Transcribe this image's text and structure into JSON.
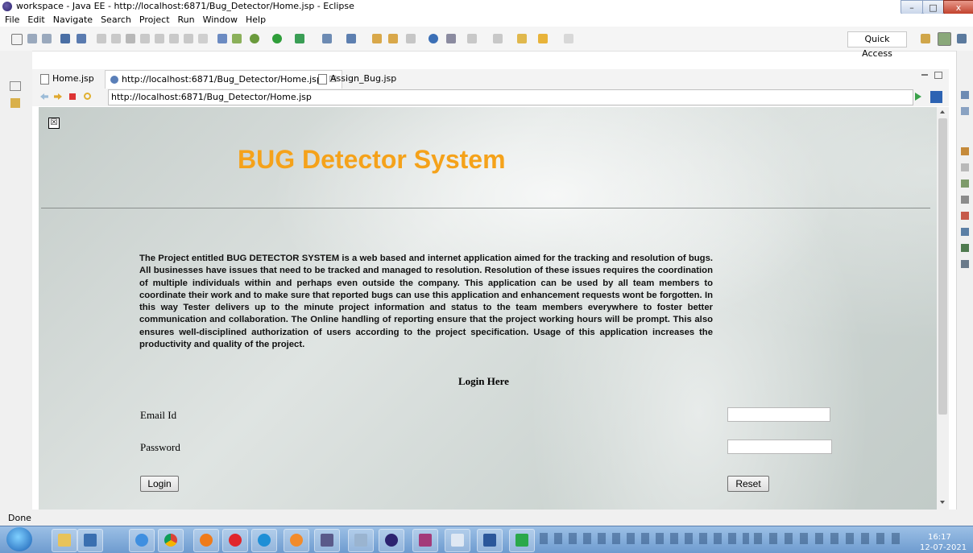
{
  "window": {
    "title": "workspace - Java EE - http://localhost:6871/Bug_Detector/Home.jsp - Eclipse",
    "controls": [
      "–",
      "□",
      "x"
    ]
  },
  "menu": [
    "File",
    "Edit",
    "Navigate",
    "Search",
    "Project",
    "Run",
    "Window",
    "Help"
  ],
  "toolbar": {
    "quick_access": "Quick Access"
  },
  "tabs": [
    {
      "label": "Home.jsp"
    },
    {
      "label": "http://localhost:6871/Bug_Detector/Home.jsp",
      "close": "☒"
    },
    {
      "label": "Assign_Bug.jsp"
    }
  ],
  "browser": {
    "url": "http://localhost:6871/Bug_Detector/Home.jsp"
  },
  "page": {
    "broken_image": "☒",
    "title": "BUG Detector System",
    "description": "The Project entitled BUG DETECTOR SYSTEM is a web based and internet application aimed for the tracking and resolution of bugs. All businesses have issues that need to be tracked and managed to resolution. Resolution of these issues requires the coordination of multiple individuals within and perhaps even outside the company. This application can be used by all team members to coordinate their work and to make sure that reported bugs can use this application and enhancement requests wont be forgotten. In this way Tester delivers up to the minute project information and status to the team members everywhere to foster better communication and collaboration. The Online handling of reporting ensure that the project working hours will be prompt. This also ensures well-disciplined authorization of users according to the project specification. Usage of this application increases the productivity and quality of the project.",
    "login_heading": "Login Here",
    "email_label": "Email Id",
    "email_value": "",
    "password_label": "Password",
    "password_value": "",
    "login_button": "Login",
    "reset_button": "Reset"
  },
  "status": {
    "text": "Done"
  },
  "taskbar": {
    "time": "16:17",
    "date": "12-07-2021"
  }
}
